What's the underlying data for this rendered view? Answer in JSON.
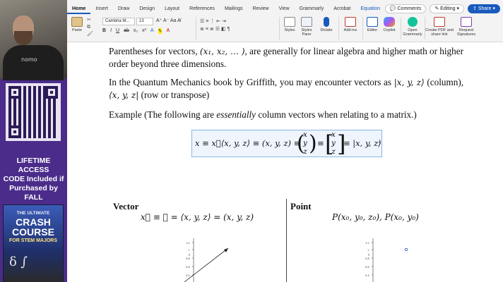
{
  "ribbon": {
    "tabs": [
      "Home",
      "Insert",
      "Draw",
      "Design",
      "Layout",
      "References",
      "Mailings",
      "Review",
      "View",
      "Grammarly",
      "Acrobat",
      "Equation"
    ],
    "active_tab": "Home",
    "comments_label": "Comments",
    "editing_label": "Editing",
    "share_label": "Share",
    "paste_label": "Paste",
    "font_name": "Cambria M...",
    "font_size": "13",
    "tools": [
      {
        "label": "Styles",
        "icon": "styles-icon"
      },
      {
        "label": "Styles Pane",
        "icon": "styles-pane-icon"
      },
      {
        "label": "Dictate",
        "icon": "microphone-icon"
      },
      {
        "label": "Add-ins",
        "icon": "add-ins-icon"
      },
      {
        "label": "Editor",
        "icon": "editor-icon"
      },
      {
        "label": "Copilot",
        "icon": "copilot-icon"
      },
      {
        "label": "Open Grammarly",
        "icon": "grammarly-icon"
      },
      {
        "label": "Create PDF and share link",
        "icon": "pdf-icon"
      },
      {
        "label": "Request Signatures",
        "icon": "signature-icon"
      }
    ],
    "accent_color": "#185abd"
  },
  "promo": {
    "shirt_text": "nomo",
    "lines": [
      "LIFETIME ACCESS",
      "CODE Included if",
      "Purchased by FALL"
    ],
    "book_kicker": "THE ULTIMATE",
    "book_title": "CRASH COURSE",
    "book_subtitle": "FOR STEM MAJORS",
    "book_symbols": "δ ∫",
    "panel_color": "#4b2c8a"
  },
  "document": {
    "p1_a": "Parentheses for vectors, ",
    "p1_math": "(x₁, x₂, … )",
    "p1_b": ", are generally for linear algebra and higher math or higher order beyond three dimensions.",
    "p2_a": "In the Quantum Mechanics book by Griffith, you may encounter vectors as ",
    "p2_ket": "|x, y, z⟩",
    "p2_b": " (column), ",
    "p2_bra": "⟨x, y, z|",
    "p2_c": " (row or transpose)",
    "p3_a": "Example (The following are ",
    "p3_em": "essentially",
    "p3_b": " column vectors when relating to a matrix.)",
    "equation_lead": "x ≡ x⃗⟨x, y, z⟩ ≡ (x, y, z) ≡",
    "column_entries": [
      "x",
      "y",
      "z"
    ],
    "equation_tail": "≡ |x, y, z⟩",
    "vector_title": "Vector",
    "vector_equation": "x⃗ ≡ 𝐱 = ⟨x, y, z⟩ = (x, y, z)",
    "point_title": "Point",
    "point_equation": "P(x₀, y₀, z₀), P(x₀, y₀)",
    "axis_ticks": [
      "1.2",
      "1",
      "0.8",
      "0.6",
      "0.4"
    ],
    "axis_label": "y"
  }
}
